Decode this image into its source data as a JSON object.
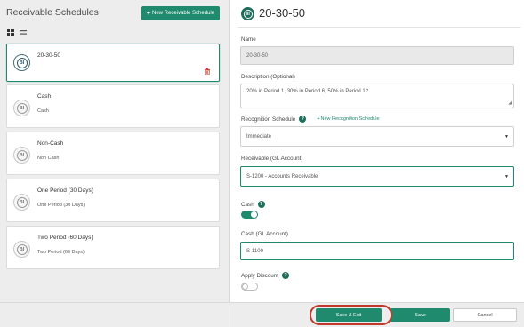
{
  "left": {
    "title": "Receivable Schedules",
    "new_button": {
      "plus": "+",
      "label": "New Receivable Schedule"
    },
    "view_icons": [
      "grid-view-icon",
      "list-view-icon"
    ],
    "cards": [
      {
        "name": "20-30-50",
        "description": "",
        "active": true,
        "badge": "BI"
      },
      {
        "name": "Cash",
        "description": "Cash",
        "active": false,
        "badge": "BI"
      },
      {
        "name": "Non-Cash",
        "description": "Non Cash",
        "active": false,
        "badge": "BI"
      },
      {
        "name": "One Period (30 Days)",
        "description": "One Period (30 Days)",
        "active": false,
        "badge": "BI"
      },
      {
        "name": "Two Period (60 Days)",
        "description": "Two Period (60 Days)",
        "active": false,
        "badge": "BI"
      }
    ]
  },
  "detail": {
    "badge": "BI",
    "title": "20-30-50",
    "name_label": "Name",
    "name_value": "20-30-50",
    "description_label": "Description (Optional)",
    "description_value": "20% in Period 1, 30% in Period 6, 50% in Period 12",
    "recognition_label": "Recognition Schedule",
    "new_recognition_link": {
      "plus": "+",
      "label": "New Recognition Schedule"
    },
    "recognition_value": "Immediate",
    "receivable_label": "Receivable (GL Account)",
    "receivable_value": "S-1200 - Accounts Receivable",
    "cash_label": "Cash",
    "cash_toggle_on": true,
    "cash_gl_label": "Cash (GL Account)",
    "cash_gl_value": "S-1100",
    "discount_label": "Apply Discount",
    "discount_toggle_on": false,
    "help_glyph": "?"
  },
  "footer": {
    "save_exit_label": "Save & Exit",
    "save_label": "Save",
    "cancel_label": "Cancel"
  },
  "colors": {
    "accent": "#1f8a6e",
    "accent_dark": "#1f6e5c",
    "highlight": "#c0392b",
    "panel_bg": "#ededed"
  }
}
